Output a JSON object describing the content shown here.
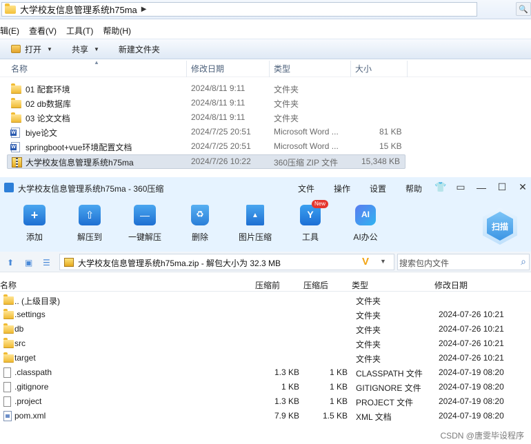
{
  "explorer": {
    "address": {
      "path": "大学校友信息管理系统h75ma",
      "sep_icon": "chevron-right-icon"
    },
    "window_controls": [
      "minimize-icon",
      "maximize-icon",
      "close-icon"
    ],
    "menu": [
      "辑(E)",
      "查看(V)",
      "工具(T)",
      "帮助(H)"
    ],
    "toolbar": {
      "open": "打开",
      "share": "共享",
      "new_folder": "新建文件夹"
    },
    "columns": {
      "name": "名称",
      "date": "修改日期",
      "type": "类型",
      "size": "大小"
    },
    "files": [
      {
        "name": "01 配套环境",
        "date": "2024/8/11 9:11",
        "type": "文件夹",
        "size": "",
        "icon": "folder-icon"
      },
      {
        "name": "02 db数据库",
        "date": "2024/8/11 9:11",
        "type": "文件夹",
        "size": "",
        "icon": "folder-icon"
      },
      {
        "name": "03 论文文档",
        "date": "2024/8/11 9:11",
        "type": "文件夹",
        "size": "",
        "icon": "folder-icon"
      },
      {
        "name": "biye论文",
        "date": "2024/7/25 20:51",
        "type": "Microsoft Word ...",
        "size": "81 KB",
        "icon": "word-document-icon"
      },
      {
        "name": "springboot+vue环境配置文档",
        "date": "2024/7/25 20:51",
        "type": "Microsoft Word ...",
        "size": "15 KB",
        "icon": "word-document-icon"
      },
      {
        "name": "大学校友信息管理系统h75ma",
        "date": "2024/7/26 10:22",
        "type": "360压缩 ZIP 文件",
        "size": "15,348 KB",
        "icon": "zip-archive-icon",
        "selected": true
      }
    ]
  },
  "zip": {
    "title": "大学校友信息管理系统h75ma - 360压缩",
    "menu": [
      "文件",
      "操作",
      "设置",
      "帮助"
    ],
    "toolbar": [
      {
        "label": "添加",
        "icon": "add-icon"
      },
      {
        "label": "解压到",
        "icon": "extract-to-icon"
      },
      {
        "label": "一键解压",
        "icon": "one-click-extract-icon"
      },
      {
        "label": "删除",
        "icon": "recycle-delete-icon"
      },
      {
        "label": "图片压缩",
        "icon": "image-compress-icon"
      },
      {
        "label": "工具",
        "icon": "tools-icon"
      },
      {
        "label": "AI办公",
        "icon": "ai-office-icon"
      }
    ],
    "new_badge": "New",
    "scan": "扫描",
    "path_text": "大学校友信息管理系统h75ma.zip - 解包大小为 32.3 MB",
    "path_v": "V",
    "search_placeholder": "搜索包内文件",
    "columns": {
      "name": "名称",
      "before": "压缩前",
      "after": "压缩后",
      "type": "类型",
      "date": "修改日期"
    },
    "files": [
      {
        "name": ".. (上级目录)",
        "before": "",
        "after": "",
        "type": "文件夹",
        "date": "",
        "icon": "folder-icon"
      },
      {
        "name": ".settings",
        "before": "",
        "after": "",
        "type": "文件夹",
        "date": "2024-07-26 10:21",
        "icon": "folder-icon"
      },
      {
        "name": "db",
        "before": "",
        "after": "",
        "type": "文件夹",
        "date": "2024-07-26 10:21",
        "icon": "folder-icon"
      },
      {
        "name": "src",
        "before": "",
        "after": "",
        "type": "文件夹",
        "date": "2024-07-26 10:21",
        "icon": "folder-icon"
      },
      {
        "name": "target",
        "before": "",
        "after": "",
        "type": "文件夹",
        "date": "2024-07-26 10:21",
        "icon": "folder-icon"
      },
      {
        "name": ".classpath",
        "before": "1.3 KB",
        "after": "1 KB",
        "type": "CLASSPATH 文件",
        "date": "2024-07-19 08:20",
        "icon": "file-icon"
      },
      {
        "name": ".gitignore",
        "before": "1 KB",
        "after": "1 KB",
        "type": "GITIGNORE 文件",
        "date": "2024-07-19 08:20",
        "icon": "file-icon"
      },
      {
        "name": ".project",
        "before": "1.3 KB",
        "after": "1 KB",
        "type": "PROJECT 文件",
        "date": "2024-07-19 08:20",
        "icon": "file-icon"
      },
      {
        "name": "pom.xml",
        "before": "7.9 KB",
        "after": "1.5 KB",
        "type": "XML 文档",
        "date": "2024-07-19 08:20",
        "icon": "xml-file-icon"
      }
    ]
  },
  "watermark": "CSDN @唐雯毕设程序"
}
